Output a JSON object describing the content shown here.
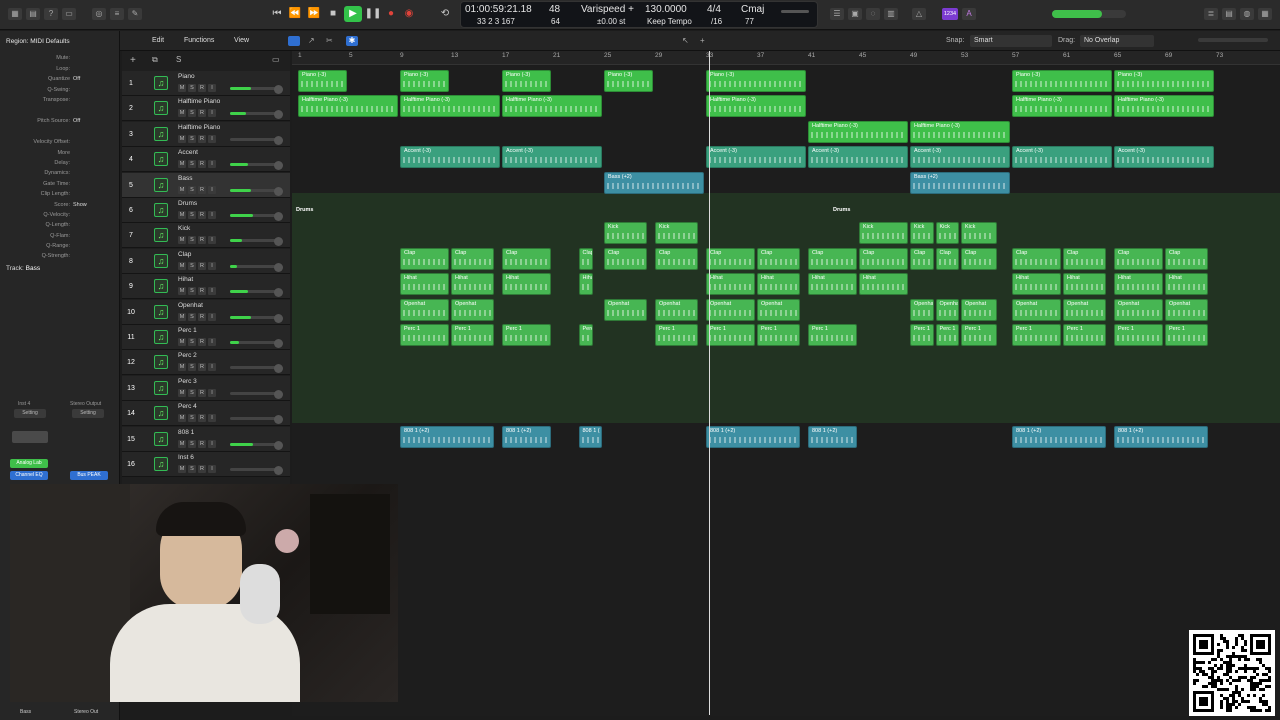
{
  "transport": {
    "position_time": "01:00:59:21.18",
    "position_bars": "33  2  3  167",
    "division_top": "48",
    "division_bottom": "64",
    "varispeed_label": "Varispeed +",
    "varispeed_value": "±0.00 st",
    "tempo": "130.0000",
    "tempo_mode": "Keep Tempo",
    "time_sig": "4/4",
    "time_sig_div": "/16",
    "key": "Cmaj",
    "key_num": "77",
    "badge": "1234"
  },
  "menu": {
    "edit": "Edit",
    "functions": "Functions",
    "view": "View",
    "snap_label": "Snap:",
    "snap_value": "Smart",
    "drag_label": "Drag:",
    "drag_value": "No Overlap"
  },
  "inspector": {
    "region_title": "Region: MIDI Defaults",
    "rows": [
      {
        "label": "Mute:",
        "value": ""
      },
      {
        "label": "Loop:",
        "value": ""
      },
      {
        "label": "Quantize",
        "value": "Off"
      },
      {
        "label": "Q-Swing:",
        "value": ""
      },
      {
        "label": "Transpose:",
        "value": ""
      },
      {
        "label": "Pitch Source:",
        "value": "Off"
      },
      {
        "label": "Velocity Offset:",
        "value": ""
      },
      {
        "label": "More",
        "value": ""
      },
      {
        "label": "Delay:",
        "value": ""
      },
      {
        "label": "Dynamics:",
        "value": ""
      },
      {
        "label": "Gate Time:",
        "value": ""
      },
      {
        "label": "Clip Length:",
        "value": ""
      },
      {
        "label": "Score:",
        "value": "Show"
      },
      {
        "label": "Q-Velocity:",
        "value": ""
      },
      {
        "label": "Q-Length:",
        "value": ""
      },
      {
        "label": "Q-Flam:",
        "value": ""
      },
      {
        "label": "Q-Range:",
        "value": ""
      },
      {
        "label": "Q-Strength:",
        "value": ""
      }
    ],
    "track_title": "Track:",
    "track_name": "Bass",
    "strip_left": {
      "setting": "Setting",
      "plugin1": "Analog Lab",
      "plugin2": "Channel EQ",
      "label": "Inst 4",
      "name": "Bass"
    },
    "strip_right": {
      "setting": "Setting",
      "plugin1": "Bus PEAK",
      "label": "Stereo Output",
      "name": "Stereo Out"
    }
  },
  "tracks": [
    {
      "num": "1",
      "name": "Piano",
      "level": 0.45
    },
    {
      "num": "2",
      "name": "Halftime Piano",
      "level": 0.35
    },
    {
      "num": "3",
      "name": "Halftime Piano",
      "level": 0.0
    },
    {
      "num": "4",
      "name": "Accent",
      "level": 0.4
    },
    {
      "num": "5",
      "name": "Bass",
      "level": 0.45
    },
    {
      "num": "6",
      "name": "Drums",
      "level": 0.5
    },
    {
      "num": "7",
      "name": "Kick",
      "level": 0.25
    },
    {
      "num": "8",
      "name": "Clap",
      "level": 0.15
    },
    {
      "num": "9",
      "name": "Hihat",
      "level": 0.4
    },
    {
      "num": "10",
      "name": "Openhat",
      "level": 0.45
    },
    {
      "num": "11",
      "name": "Perc 1",
      "level": 0.2
    },
    {
      "num": "12",
      "name": "Perc 2",
      "level": 0.0
    },
    {
      "num": "13",
      "name": "Perc 3",
      "level": 0.0
    },
    {
      "num": "14",
      "name": "Perc 4",
      "level": 0.0
    },
    {
      "num": "15",
      "name": "808 1",
      "level": 0.5
    },
    {
      "num": "16",
      "name": "Inst 6",
      "level": 0.0
    }
  ],
  "msr": {
    "m": "M",
    "s": "S",
    "r": "R",
    "i": "I"
  },
  "ruler": {
    "bars": [
      "1",
      "5",
      "9",
      "13",
      "17",
      "21",
      "25",
      "29",
      "33",
      "37",
      "41",
      "45",
      "49",
      "53",
      "57",
      "61",
      "65",
      "69",
      "73"
    ]
  },
  "regions": [
    {
      "track": 0,
      "bar": 1,
      "len": 4,
      "label": "Piano (-3)",
      "color": "green"
    },
    {
      "track": 0,
      "bar": 9,
      "len": 4,
      "label": "Piano (-3)",
      "color": "green"
    },
    {
      "track": 0,
      "bar": 17,
      "len": 4,
      "label": "Piano (-3)",
      "color": "green"
    },
    {
      "track": 0,
      "bar": 25,
      "len": 4,
      "label": "Piano (-3)",
      "color": "green"
    },
    {
      "track": 0,
      "bar": 33,
      "len": 8,
      "label": "Piano (-3)",
      "color": "green"
    },
    {
      "track": 0,
      "bar": 57,
      "len": 8,
      "label": "Piano (-3)",
      "color": "green"
    },
    {
      "track": 0,
      "bar": 65,
      "len": 8,
      "label": "Piano (-3)",
      "color": "green"
    },
    {
      "track": 1,
      "bar": 1,
      "len": 8,
      "label": "Halftime Piano (-3)",
      "color": "green"
    },
    {
      "track": 1,
      "bar": 9,
      "len": 8,
      "label": "Halftime Piano (-3)",
      "color": "green"
    },
    {
      "track": 1,
      "bar": 17,
      "len": 8,
      "label": "Halftime Piano (-3)",
      "color": "green"
    },
    {
      "track": 1,
      "bar": 33,
      "len": 8,
      "label": "Halftime Piano (-3)",
      "color": "green"
    },
    {
      "track": 1,
      "bar": 57,
      "len": 8,
      "label": "Halftime Piano (-3)",
      "color": "green"
    },
    {
      "track": 1,
      "bar": 65,
      "len": 8,
      "label": "Halftime Piano (-3)",
      "color": "green"
    },
    {
      "track": 2,
      "bar": 41,
      "len": 8,
      "label": "Halftime Piano (-3)",
      "color": "green"
    },
    {
      "track": 2,
      "bar": 49,
      "len": 8,
      "label": "Halftime Piano (-3)",
      "color": "green"
    },
    {
      "track": 3,
      "bar": 9,
      "len": 8,
      "label": "Accent (-3)",
      "color": "teal"
    },
    {
      "track": 3,
      "bar": 17,
      "len": 8,
      "label": "Accent (-3)",
      "color": "teal"
    },
    {
      "track": 3,
      "bar": 33,
      "len": 8,
      "label": "Accent (-3)",
      "color": "teal"
    },
    {
      "track": 3,
      "bar": 41,
      "len": 8,
      "label": "Accent (-3)",
      "color": "teal"
    },
    {
      "track": 3,
      "bar": 49,
      "len": 8,
      "label": "Accent (-3)",
      "color": "teal"
    },
    {
      "track": 3,
      "bar": 57,
      "len": 8,
      "label": "Accent (-3)",
      "color": "teal"
    },
    {
      "track": 3,
      "bar": 65,
      "len": 8,
      "label": "Accent (-3)",
      "color": "teal"
    },
    {
      "track": 4,
      "bar": 25,
      "len": 8,
      "label": "Bass (+2)",
      "color": "blue"
    },
    {
      "track": 4,
      "bar": 49,
      "len": 8,
      "label": "Bass (+2)",
      "color": "blue"
    },
    {
      "track": 6,
      "bar": 25,
      "len": 3.5,
      "label": "Kick",
      "color": "lgreen"
    },
    {
      "track": 6,
      "bar": 29,
      "len": 3.5,
      "label": "Kick",
      "color": "lgreen"
    },
    {
      "track": 6,
      "bar": 45,
      "len": 4,
      "label": "Kick",
      "color": "lgreen"
    },
    {
      "track": 6,
      "bar": 49,
      "len": 2,
      "label": "Kick",
      "color": "lgreen"
    },
    {
      "track": 6,
      "bar": 51,
      "len": 2,
      "label": "Kick",
      "color": "lgreen"
    },
    {
      "track": 6,
      "bar": 53,
      "len": 3,
      "label": "Kick",
      "color": "lgreen"
    },
    {
      "track": 7,
      "bar": 9,
      "len": 4,
      "label": "Clap",
      "color": "lgreen"
    },
    {
      "track": 7,
      "bar": 13,
      "len": 3.5,
      "label": "Clap",
      "color": "lgreen"
    },
    {
      "track": 7,
      "bar": 17,
      "len": 4,
      "label": "Clap",
      "color": "lgreen"
    },
    {
      "track": 7,
      "bar": 23,
      "len": 1.3,
      "label": "Clap",
      "color": "lgreen"
    },
    {
      "track": 7,
      "bar": 25,
      "len": 3.5,
      "label": "Clap",
      "color": "lgreen"
    },
    {
      "track": 7,
      "bar": 29,
      "len": 3.5,
      "label": "Clap",
      "color": "lgreen"
    },
    {
      "track": 7,
      "bar": 33,
      "len": 4,
      "label": "Clap",
      "color": "lgreen"
    },
    {
      "track": 7,
      "bar": 37,
      "len": 3.5,
      "label": "Clap",
      "color": "lgreen"
    },
    {
      "track": 7,
      "bar": 41,
      "len": 4,
      "label": "Clap",
      "color": "lgreen"
    },
    {
      "track": 7,
      "bar": 45,
      "len": 4,
      "label": "Clap",
      "color": "lgreen"
    },
    {
      "track": 7,
      "bar": 49,
      "len": 2,
      "label": "Clap",
      "color": "lgreen"
    },
    {
      "track": 7,
      "bar": 51,
      "len": 2,
      "label": "Clap",
      "color": "lgreen"
    },
    {
      "track": 7,
      "bar": 53,
      "len": 3,
      "label": "Clap",
      "color": "lgreen"
    },
    {
      "track": 7,
      "bar": 57,
      "len": 4,
      "label": "Clap",
      "color": "lgreen"
    },
    {
      "track": 7,
      "bar": 61,
      "len": 3.5,
      "label": "Clap",
      "color": "lgreen"
    },
    {
      "track": 7,
      "bar": 65,
      "len": 4,
      "label": "Clap",
      "color": "lgreen"
    },
    {
      "track": 7,
      "bar": 69,
      "len": 3.5,
      "label": "Clap",
      "color": "lgreen"
    },
    {
      "track": 8,
      "bar": 9,
      "len": 4,
      "label": "Hihat",
      "color": "lgreen"
    },
    {
      "track": 8,
      "bar": 13,
      "len": 3.5,
      "label": "Hihat",
      "color": "lgreen"
    },
    {
      "track": 8,
      "bar": 17,
      "len": 4,
      "label": "Hihat",
      "color": "lgreen"
    },
    {
      "track": 8,
      "bar": 23,
      "len": 1.3,
      "label": "Hihat",
      "color": "lgreen"
    },
    {
      "track": 8,
      "bar": 33,
      "len": 4,
      "label": "Hihat",
      "color": "lgreen"
    },
    {
      "track": 8,
      "bar": 37,
      "len": 3.5,
      "label": "Hihat",
      "color": "lgreen"
    },
    {
      "track": 8,
      "bar": 41,
      "len": 4,
      "label": "Hihat",
      "color": "lgreen"
    },
    {
      "track": 8,
      "bar": 45,
      "len": 4,
      "label": "Hihat",
      "color": "lgreen"
    },
    {
      "track": 8,
      "bar": 57,
      "len": 4,
      "label": "Hihat",
      "color": "lgreen"
    },
    {
      "track": 8,
      "bar": 61,
      "len": 3.5,
      "label": "Hihat",
      "color": "lgreen"
    },
    {
      "track": 8,
      "bar": 65,
      "len": 4,
      "label": "Hihat",
      "color": "lgreen"
    },
    {
      "track": 8,
      "bar": 69,
      "len": 3.5,
      "label": "Hihat",
      "color": "lgreen"
    },
    {
      "track": 9,
      "bar": 9,
      "len": 4,
      "label": "Openhat",
      "color": "lgreen"
    },
    {
      "track": 9,
      "bar": 13,
      "len": 3.5,
      "label": "Openhat",
      "color": "lgreen"
    },
    {
      "track": 9,
      "bar": 25,
      "len": 3.5,
      "label": "Openhat",
      "color": "lgreen"
    },
    {
      "track": 9,
      "bar": 29,
      "len": 3.5,
      "label": "Openhat",
      "color": "lgreen"
    },
    {
      "track": 9,
      "bar": 33,
      "len": 4,
      "label": "Openhat",
      "color": "lgreen"
    },
    {
      "track": 9,
      "bar": 37,
      "len": 3.5,
      "label": "Openhat",
      "color": "lgreen"
    },
    {
      "track": 9,
      "bar": 49,
      "len": 2,
      "label": "Openhat",
      "color": "lgreen"
    },
    {
      "track": 9,
      "bar": 51,
      "len": 2,
      "label": "Openhat",
      "color": "lgreen"
    },
    {
      "track": 9,
      "bar": 53,
      "len": 3,
      "label": "Openhat",
      "color": "lgreen"
    },
    {
      "track": 9,
      "bar": 57,
      "len": 4,
      "label": "Openhat",
      "color": "lgreen"
    },
    {
      "track": 9,
      "bar": 61,
      "len": 3.5,
      "label": "Openhat",
      "color": "lgreen"
    },
    {
      "track": 9,
      "bar": 65,
      "len": 4,
      "label": "Openhat",
      "color": "lgreen"
    },
    {
      "track": 9,
      "bar": 69,
      "len": 3.5,
      "label": "Openhat",
      "color": "lgreen"
    },
    {
      "track": 10,
      "bar": 9,
      "len": 4,
      "label": "Perc 1",
      "color": "lgreen"
    },
    {
      "track": 10,
      "bar": 13,
      "len": 3.5,
      "label": "Perc 1",
      "color": "lgreen"
    },
    {
      "track": 10,
      "bar": 17,
      "len": 4,
      "label": "Perc 1",
      "color": "lgreen"
    },
    {
      "track": 10,
      "bar": 23,
      "len": 1.3,
      "label": "Perc",
      "color": "lgreen"
    },
    {
      "track": 10,
      "bar": 29,
      "len": 3.5,
      "label": "Perc 1",
      "color": "lgreen"
    },
    {
      "track": 10,
      "bar": 33,
      "len": 4,
      "label": "Perc 1",
      "color": "lgreen"
    },
    {
      "track": 10,
      "bar": 37,
      "len": 3.5,
      "label": "Perc 1",
      "color": "lgreen"
    },
    {
      "track": 10,
      "bar": 41,
      "len": 4,
      "label": "Perc 1",
      "color": "lgreen"
    },
    {
      "track": 10,
      "bar": 49,
      "len": 2,
      "label": "Perc 1",
      "color": "lgreen"
    },
    {
      "track": 10,
      "bar": 51,
      "len": 2,
      "label": "Perc 1",
      "color": "lgreen"
    },
    {
      "track": 10,
      "bar": 53,
      "len": 3,
      "label": "Perc 1",
      "color": "lgreen"
    },
    {
      "track": 10,
      "bar": 57,
      "len": 4,
      "label": "Perc 1",
      "color": "lgreen"
    },
    {
      "track": 10,
      "bar": 61,
      "len": 3.5,
      "label": "Perc 1",
      "color": "lgreen"
    },
    {
      "track": 10,
      "bar": 65,
      "len": 4,
      "label": "Perc 1",
      "color": "lgreen"
    },
    {
      "track": 10,
      "bar": 69,
      "len": 3.5,
      "label": "Perc 1",
      "color": "lgreen"
    },
    {
      "track": 14,
      "bar": 9,
      "len": 7.5,
      "label": "808 1 (+2)",
      "color": "blue"
    },
    {
      "track": 14,
      "bar": 17,
      "len": 4,
      "label": "808 1 (+2)",
      "color": "blue"
    },
    {
      "track": 14,
      "bar": 23,
      "len": 2,
      "label": "808 1 (",
      "color": "blue"
    },
    {
      "track": 14,
      "bar": 33,
      "len": 7.5,
      "label": "808 1 (+2)",
      "color": "blue"
    },
    {
      "track": 14,
      "bar": 41,
      "len": 4,
      "label": "808 1 (+2)",
      "color": "blue"
    },
    {
      "track": 14,
      "bar": 57,
      "len": 7.5,
      "label": "808 1 (+2)",
      "color": "blue"
    },
    {
      "track": 14,
      "bar": 65,
      "len": 7.5,
      "label": "808 1 (+2)",
      "color": "blue"
    }
  ],
  "drums_folder": {
    "label1": "Drums",
    "label2": "Drums"
  },
  "colors": {
    "green": "#3fbf4a",
    "lgreen": "#47b653",
    "teal": "#3aa07e",
    "blue": "#3d8fa3",
    "play": "#33c24a",
    "record": "#e0433a"
  }
}
